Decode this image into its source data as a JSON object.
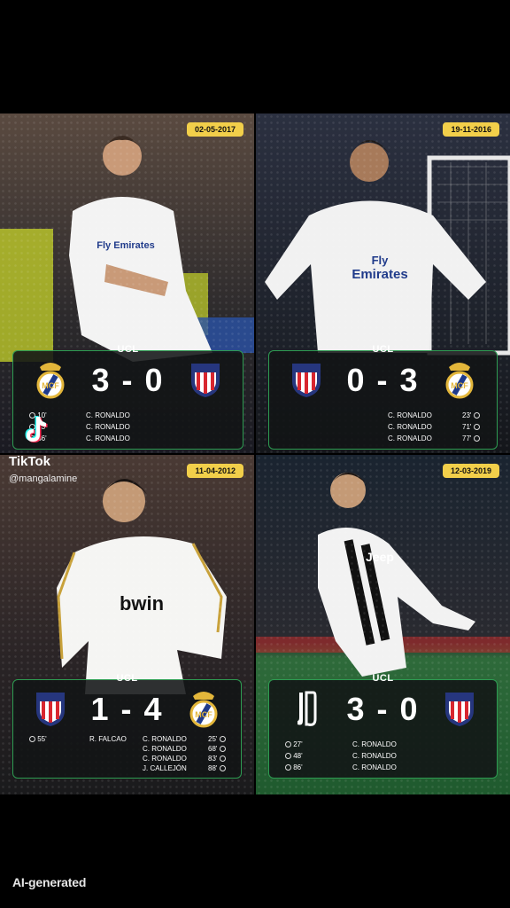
{
  "panels": [
    {
      "date": "02-05-2017",
      "competition": "UCL",
      "score": "3 - 0",
      "home_crest_icon": "real-madrid-crest-icon",
      "away_crest_icon": "atletico-madrid-crest-icon",
      "scorers_left": [
        {
          "name": "C. RONALDO",
          "minute": "10'"
        },
        {
          "name": "C. RONALDO",
          "minute": "73'"
        },
        {
          "name": "C. RONALDO",
          "minute": "86'"
        }
      ]
    },
    {
      "date": "19-11-2016",
      "competition": "UCL",
      "score": "0 - 3",
      "home_crest_icon": "atletico-madrid-crest-icon",
      "away_crest_icon": "real-madrid-crest-icon",
      "scorers_right": [
        {
          "name": "C. RONALDO",
          "minute": "23'"
        },
        {
          "name": "C. RONALDO",
          "minute": "71'"
        },
        {
          "name": "C. RONALDO",
          "minute": "77'"
        }
      ]
    },
    {
      "date": "11-04-2012",
      "competition": "UCL",
      "score": "1 - 4",
      "home_crest_icon": "atletico-madrid-crest-icon",
      "away_crest_icon": "real-madrid-crest-icon",
      "scorers_left": [
        {
          "name": "R. FALCAO",
          "minute": "55'"
        }
      ],
      "scorers_right": [
        {
          "name": "C. RONALDO",
          "minute": "25'"
        },
        {
          "name": "C. RONALDO",
          "minute": "68'"
        },
        {
          "name": "C. RONALDO",
          "minute": "83'"
        },
        {
          "name": "J. CALLEJÓN",
          "minute": "88'"
        }
      ]
    },
    {
      "date": "12-03-2019",
      "competition": "UCL",
      "score": "3 - 0",
      "home_crest_icon": "juventus-crest-icon",
      "away_crest_icon": "atletico-madrid-crest-icon",
      "scorers_left": [
        {
          "name": "C. RONALDO",
          "minute": "27'"
        },
        {
          "name": "C. RONALDO",
          "minute": "48'"
        },
        {
          "name": "C. RONALDO",
          "minute": "86'"
        }
      ]
    }
  ],
  "jersey_text": {
    "p1": "Fly Emirates",
    "p2_line1": "Fly",
    "p2_line2": "Emirates",
    "p3": "bwin",
    "p4": "Jeep"
  },
  "watermark": {
    "brand": "TikTok",
    "handle": "@mangalamine"
  },
  "ai_label": "AI-generated",
  "colors": {
    "date_badge": "#f2cf4a",
    "card_border": "#2e9c52",
    "real_madrid_gold": "#e3b63a",
    "atletico_red": "#d8262f",
    "atletico_blue": "#26367e"
  }
}
